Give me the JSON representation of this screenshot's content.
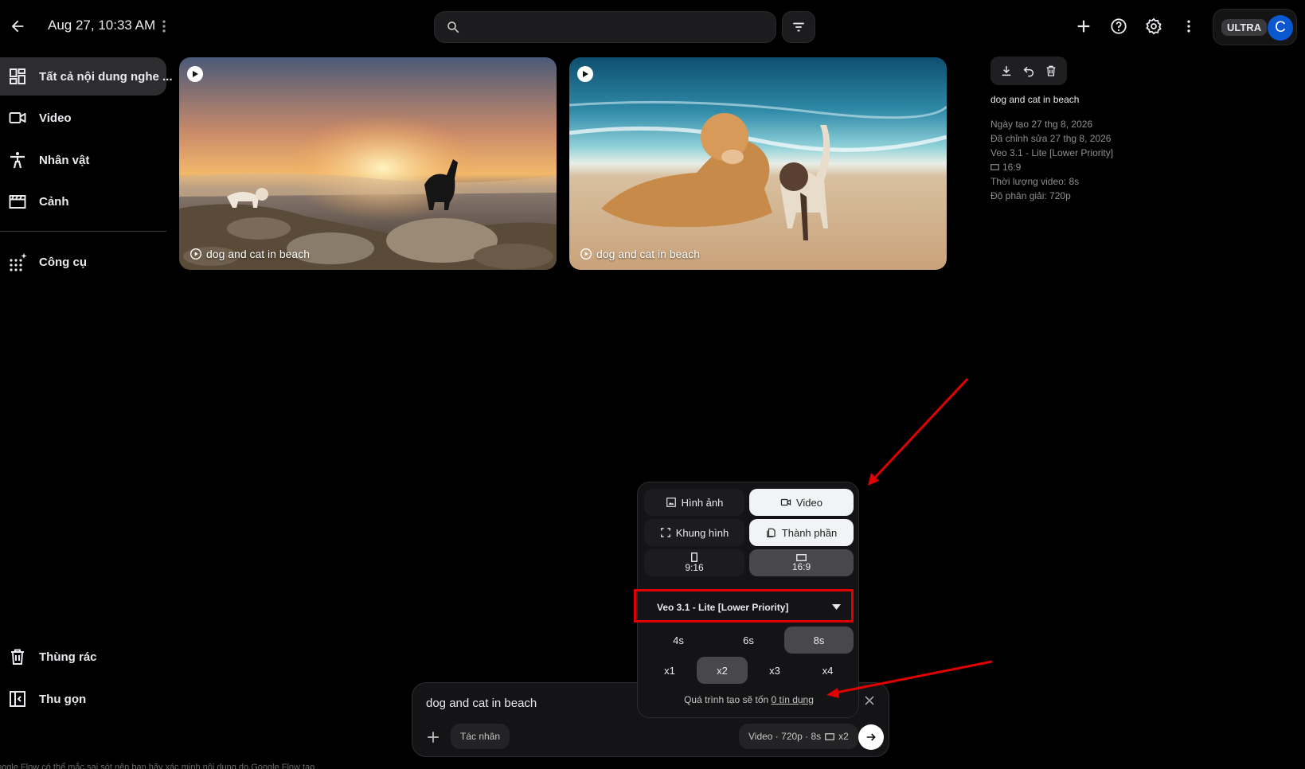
{
  "header": {
    "title": "Aug 27, 10:33 AM",
    "search_placeholder": "",
    "plan_badge": "ULTRA",
    "avatar_letter": "C"
  },
  "sidebar": {
    "items": [
      {
        "label": "Tất cả nội dung nghe ...",
        "icon": "dashboard-icon"
      },
      {
        "label": "Video",
        "icon": "video-camera-icon"
      },
      {
        "label": "Nhân vật",
        "icon": "person-icon"
      },
      {
        "label": "Cảnh",
        "icon": "movie-clapper-icon"
      },
      {
        "label": "Công cụ",
        "icon": "apps-sparkle-icon"
      }
    ],
    "bottom_items": [
      {
        "label": "Thùng rác",
        "icon": "trash-icon"
      },
      {
        "label": "Thu gọn",
        "icon": "collapse-sidebar-icon"
      }
    ]
  },
  "gallery": {
    "cards": [
      {
        "caption": "dog and cat in beach"
      },
      {
        "caption": "dog and cat in beach"
      }
    ]
  },
  "details": {
    "title": "dog and cat in beach",
    "created": "Ngày tạo 27 thg 8, 2026",
    "edited": "Đã chỉnh sửa 27 thg 8, 2026",
    "model": "Veo 3.1 - Lite [Lower Priority]",
    "ratio": "16:9",
    "duration": "Thời lượng video: 8s",
    "resolution": "Độ phân giải: 720p"
  },
  "popup": {
    "type_options": [
      {
        "label": "Hình ảnh",
        "selected": false
      },
      {
        "label": "Video",
        "selected": true
      }
    ],
    "mode_options": [
      {
        "label": "Khung hình",
        "selected": false
      },
      {
        "label": "Thành phần",
        "selected": true
      }
    ],
    "ratio_options": [
      {
        "label": "9:16",
        "selected": false
      },
      {
        "label": "16:9",
        "selected": true
      }
    ],
    "model_value": "Veo 3.1 - Lite [Lower Priority]",
    "duration_options": [
      {
        "label": "4s",
        "selected": false
      },
      {
        "label": "6s",
        "selected": false
      },
      {
        "label": "8s",
        "selected": true
      }
    ],
    "count_options": [
      {
        "label": "x1",
        "selected": false
      },
      {
        "label": "x2",
        "selected": true
      },
      {
        "label": "x3",
        "selected": false
      },
      {
        "label": "x4",
        "selected": false
      }
    ],
    "cost_text": "Quá trình tạo sẽ tốn",
    "cost_link": "0 tín dụng"
  },
  "prompt": {
    "text": "dog and cat in beach",
    "agent_chip": "Tác nhân",
    "settings_chip": "Video · 720p · 8s",
    "settings_count": "x2"
  },
  "footer_note": "oogle Flow có thể mắc sai sót nên bạn hãy xác minh nội dung do Google Flow tạo",
  "colors": {
    "background": "#000000",
    "accent_blue": "#0b57d0",
    "annotation_red": "#e00000"
  }
}
